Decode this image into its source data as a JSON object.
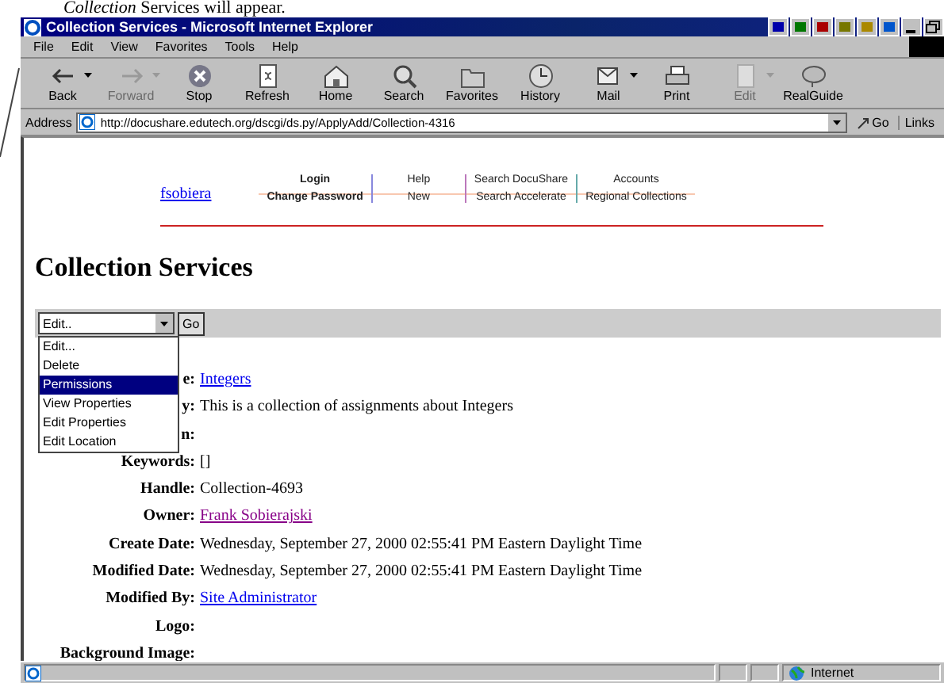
{
  "caption": "*Collection* Services will appear.",
  "window": {
    "title": "Collection Services - Microsoft Internet Explorer"
  },
  "menu": [
    "File",
    "Edit",
    "View",
    "Favorites",
    "Tools",
    "Help"
  ],
  "toolbar": [
    {
      "label": "Back",
      "kind": "back",
      "disabled": false,
      "dropdown": true
    },
    {
      "label": "Forward",
      "kind": "forward",
      "disabled": true,
      "dropdown": true
    },
    {
      "label": "Stop",
      "kind": "stop",
      "disabled": false,
      "dropdown": false
    },
    {
      "label": "Refresh",
      "kind": "refresh",
      "disabled": false,
      "dropdown": false
    },
    {
      "label": "Home",
      "kind": "home",
      "disabled": false,
      "dropdown": false
    },
    {
      "label": "Search",
      "kind": "search",
      "disabled": false,
      "dropdown": false
    },
    {
      "label": "Favorites",
      "kind": "favorites",
      "disabled": false,
      "dropdown": false
    },
    {
      "label": "History",
      "kind": "history",
      "disabled": false,
      "dropdown": false
    },
    {
      "label": "Mail",
      "kind": "mail",
      "disabled": false,
      "dropdown": true
    },
    {
      "label": "Print",
      "kind": "print",
      "disabled": false,
      "dropdown": false
    },
    {
      "label": "Edit",
      "kind": "edit",
      "disabled": true,
      "dropdown": true
    },
    {
      "label": "RealGuide",
      "kind": "realguide",
      "disabled": false,
      "dropdown": false
    }
  ],
  "address": {
    "label": "Address",
    "url": "http://docushare.edutech.org/dscgi/ds.py/ApplyAdd/Collection-4316",
    "go": "Go",
    "links": "Links"
  },
  "page": {
    "user_link": "fsobiera",
    "nav": [
      {
        "top": "Login",
        "bottom": "Change Password",
        "color": "#8888dd"
      },
      {
        "top": "Help",
        "bottom": "New",
        "color": "#bb77bb"
      },
      {
        "top": "Search DocuShare",
        "bottom": "Search Accelerate",
        "color": "#66aaaa"
      },
      {
        "top": "Accounts",
        "bottom": "Regional Collections",
        "color": "#ffffff"
      }
    ],
    "heading": "Collection Services",
    "action_select": {
      "value": "Edit..",
      "go": "Go",
      "expanded": true,
      "options": [
        {
          "label": "Edit...",
          "selected": false
        },
        {
          "label": "Delete",
          "selected": false
        },
        {
          "label": "Permissions",
          "selected": true
        },
        {
          "label": "View Properties",
          "selected": false
        },
        {
          "label": "Edit Properties",
          "selected": false
        },
        {
          "label": "Edit Location",
          "selected": false
        }
      ]
    },
    "fields": [
      {
        "label": "e:",
        "value": "Integers",
        "kind": "link"
      },
      {
        "label": "y:",
        "value": "This is a collection of assignments about Integers",
        "kind": "text"
      },
      {
        "label": "n:"
      },
      {
        "label": "Keywords:",
        "value": "[]",
        "kind": "text"
      },
      {
        "label": "Handle:",
        "value": "Collection-4693",
        "kind": "text"
      },
      {
        "label": "Owner:",
        "value": "Frank Sobierajski",
        "kind": "visited"
      },
      {
        "label": "Create Date:",
        "value": "Wednesday, September 27, 2000 02:55:41 PM Eastern Daylight Time",
        "kind": "text"
      },
      {
        "label": "Modified Date:",
        "value": "Wednesday, September 27, 2000 02:55:41 PM Eastern Daylight Time",
        "kind": "text"
      },
      {
        "label": "Modified By:",
        "value": "Site Administrator",
        "kind": "link"
      },
      {
        "label": "Logo:"
      },
      {
        "label": "Background Image:"
      }
    ]
  },
  "status_bar": {
    "zone": "Internet"
  }
}
